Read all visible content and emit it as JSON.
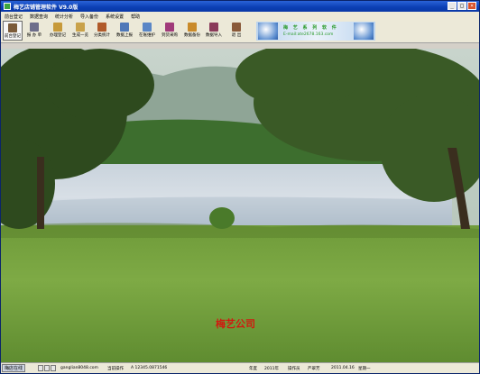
{
  "window": {
    "title": "梅艺店铺管理软件 V9.0版",
    "controls": {
      "minimize": "_",
      "maximize": "□",
      "close": "×"
    }
  },
  "menu": [
    "前台登记",
    "数据查询",
    "统计分析",
    "导入备份",
    "系统设置",
    "帮助"
  ],
  "toolbar": [
    {
      "label": "前台登记",
      "icon": "register-icon",
      "color": "#7b5b3a"
    },
    {
      "label": "报 办 单",
      "icon": "tools-icon",
      "color": "#6d6d8a"
    },
    {
      "label": "办理登记",
      "icon": "hat-icon",
      "color": "#c79a3a"
    },
    {
      "label": "生成一览",
      "icon": "lock-icon",
      "color": "#c9a24a"
    },
    {
      "label": "分类统计",
      "icon": "chart-icon",
      "color": "#b05a2a"
    },
    {
      "label": "数据上报",
      "icon": "upload-icon",
      "color": "#4f78b8"
    },
    {
      "label": "在账维护",
      "icon": "book-icon",
      "color": "#5a86c6"
    },
    {
      "label": "到货采购",
      "icon": "cart-icon",
      "color": "#a03a7a"
    },
    {
      "label": "数据备份",
      "icon": "backup-icon",
      "color": "#c98a2a"
    },
    {
      "label": "数据导入",
      "icon": "import-icon",
      "color": "#8a3a5a"
    },
    {
      "label": "退 出",
      "icon": "exit-icon",
      "color": "#8a5a3a"
    }
  ],
  "banner": {
    "line1": "梅 艺 系 列 软 件",
    "line2": "E-mail:ate2678.163.com"
  },
  "company_name": "梅艺公司",
  "statusbar": {
    "start_button": "梅店在线",
    "website": "ganglian8048.com",
    "current_user_label": "当前操作",
    "current_user_value": "A 12345.0871546",
    "year_label": "年度",
    "year_value": "2011年",
    "operator_label": "操作员",
    "operator_value": "严翠芳",
    "date_value": "2011.04.16",
    "weekday_value": "星期一"
  }
}
